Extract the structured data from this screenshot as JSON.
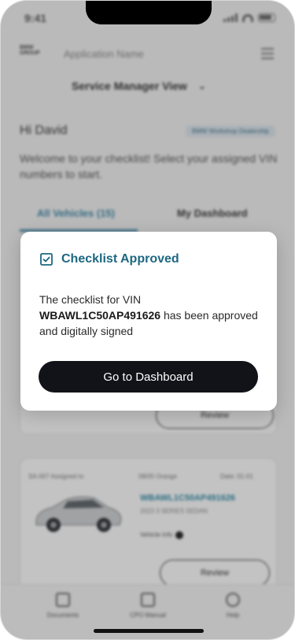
{
  "status_bar": {
    "time": "9:41"
  },
  "header": {
    "logo_text": "BMW GROUP",
    "app_name": "Application Name"
  },
  "view_selector": {
    "label": "Service Manager View"
  },
  "greeting": {
    "text": "Hi David",
    "badge": "BMW Workshop Dealership"
  },
  "welcome_text": "Welcome to your checklist! Select your assigned VIN numbers to start.",
  "tabs": [
    {
      "label": "All Vehicles (15)"
    },
    {
      "label": "My Dashboard"
    }
  ],
  "vehicle_card": {
    "meta": [
      "SA-007 Assigned to",
      "08/05 Orange",
      "Date: 01-01"
    ],
    "vin": "WBAWL1C50AP491626",
    "model": "2023 3 SERIES SEDAN",
    "info_label": "Vehicle Info",
    "review_label": "Review",
    "top_card_button": "Review"
  },
  "bottom_nav": [
    {
      "label": "Documents"
    },
    {
      "label": "CPO Manual"
    },
    {
      "label": "Help"
    }
  ],
  "modal": {
    "title": "Checklist Approved",
    "body_prefix": "The checklist for VIN",
    "vin": "WBAWL1C50AP491626",
    "body_suffix": "has been approved and digitally signed",
    "button_label": "Go to Dashboard",
    "accent_color": "#1d6780"
  }
}
